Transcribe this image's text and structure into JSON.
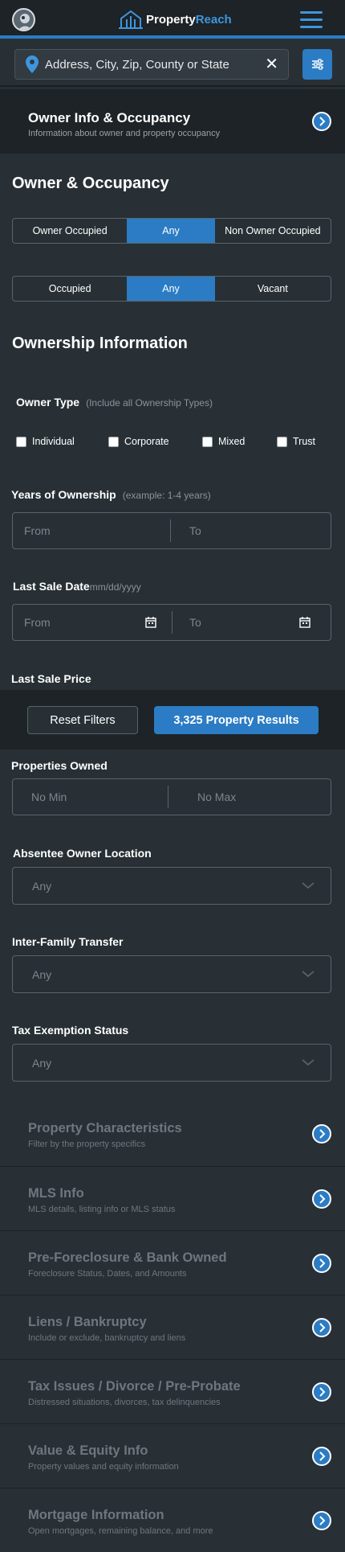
{
  "header": {
    "logo_part1": "Property",
    "logo_part2": "Reach"
  },
  "search": {
    "placeholder": "Address, City, Zip, County or State",
    "clear": "✕"
  },
  "owner_section": {
    "title": "Owner Info & Occupancy",
    "subtitle": "Information about owner and property occupancy"
  },
  "owner_occupancy": {
    "heading": "Owner & Occupancy",
    "owner_segment": [
      "Owner Occupied",
      "Any",
      "Non Owner Occupied"
    ],
    "owner_selected": "Any",
    "occupied_segment": [
      "Occupied",
      "Any",
      "Vacant"
    ],
    "occupied_selected": "Any"
  },
  "ownership": {
    "heading": "Ownership Information",
    "owner_type_label": "Owner Type",
    "owner_type_hint": "(Include all Ownership Types)",
    "owner_types": [
      "Individual",
      "Corporate",
      "Mixed",
      "Trust"
    ],
    "years_label": "Years of Ownership",
    "years_hint": "(example: 1-4 years)",
    "from": "From",
    "to": "To",
    "last_sale_date_label": "Last Sale Date",
    "last_sale_date_hint": "mm/dd/yyyy",
    "last_sale_price_label": "Last Sale Price",
    "properties_owned_label": "Properties Owned",
    "no_min": "No Min",
    "no_max": "No Max",
    "absentee_label": "Absentee Owner Location",
    "absentee_value": "Any",
    "inter_family_label": "Inter-Family Transfer",
    "inter_family_value": "Any",
    "tax_exempt_label": "Tax Exemption Status",
    "tax_exempt_value": "Any"
  },
  "footer": {
    "reset": "Reset Filters",
    "results": "3,325 Property Results"
  },
  "categories": [
    {
      "title": "Property Characteristics",
      "subtitle": "Filter by the property specifics"
    },
    {
      "title": "MLS Info",
      "subtitle": "MLS details, listing info or MLS status"
    },
    {
      "title": "Pre-Foreclosure & Bank Owned",
      "subtitle": "Foreclosure Status, Dates, and Amounts"
    },
    {
      "title": "Liens / Bankruptcy",
      "subtitle": "Include or exclude, bankruptcy and liens"
    },
    {
      "title": "Tax Issues / Divorce / Pre-Probate",
      "subtitle": "Distressed situations, divorces, tax delinquencies"
    },
    {
      "title": "Value & Equity Info",
      "subtitle": "Property values and equity information"
    },
    {
      "title": "Mortgage Information",
      "subtitle": "Open mortgages, remaining balance, and more"
    }
  ],
  "colors": {
    "accent": "#2b7cc4",
    "background": "#283035",
    "header": "#1d2327"
  }
}
